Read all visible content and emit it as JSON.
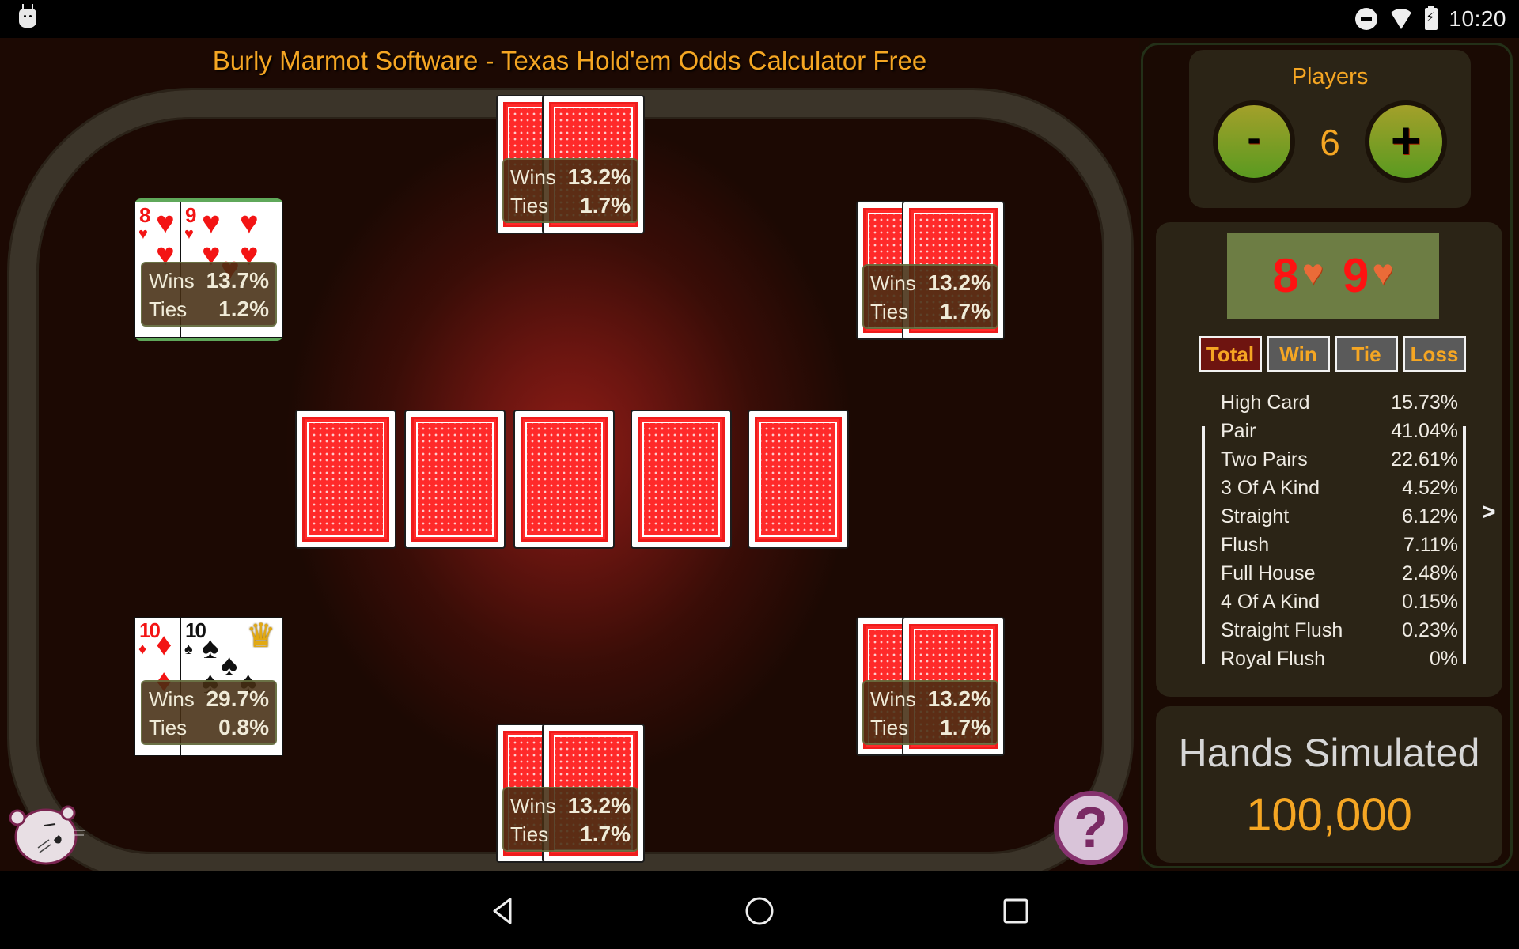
{
  "status_bar": {
    "time": "10:20",
    "icons": [
      "android-debug-icon",
      "do-not-disturb-icon",
      "wifi-icon",
      "battery-charging-icon"
    ]
  },
  "app": {
    "title": "Burly Marmot Software - Texas Hold'em Odds Calculator Free"
  },
  "labels": {
    "wins": "Wins",
    "ties": "Ties"
  },
  "players_seats": [
    {
      "seat": "top",
      "cards": [
        "back",
        "back"
      ],
      "wins": "13.2%",
      "ties": "1.7%"
    },
    {
      "seat": "top-left",
      "cards": [
        "8♥",
        "9♥"
      ],
      "wins": "13.7%",
      "ties": "1.2%",
      "selected": true
    },
    {
      "seat": "top-right",
      "cards": [
        "back",
        "back"
      ],
      "wins": "13.2%",
      "ties": "1.7%"
    },
    {
      "seat": "bottom-left",
      "cards": [
        "10♦",
        "10♠"
      ],
      "wins": "29.7%",
      "ties": "0.8%",
      "leader_crown": true
    },
    {
      "seat": "bottom-right",
      "cards": [
        "back",
        "back"
      ],
      "wins": "13.2%",
      "ties": "1.7%"
    },
    {
      "seat": "bottom",
      "cards": [
        "back",
        "back"
      ],
      "wins": "13.2%",
      "ties": "1.7%"
    }
  ],
  "community_cards": [
    "back",
    "back",
    "back",
    "back",
    "back"
  ],
  "cards": {
    "eight_rank": "8",
    "nine_rank": "9",
    "ten_rank": "10",
    "heart": "♥",
    "diamond": "♦",
    "spade": "♠",
    "crown": "♛"
  },
  "side_panel": {
    "players": {
      "label": "Players",
      "count": "6",
      "minus_label": "-",
      "plus_label": "+"
    },
    "selected_hand": {
      "card1_rank": "8",
      "card1_suit": "♥",
      "card2_rank": "9",
      "card2_suit": "♥"
    },
    "tabs": [
      {
        "label": "Total",
        "active": true
      },
      {
        "label": "Win",
        "active": false
      },
      {
        "label": "Tie",
        "active": false
      },
      {
        "label": "Loss",
        "active": false
      }
    ],
    "hand_stats": [
      {
        "name": "High Card",
        "pct": "15.73%"
      },
      {
        "name": "Pair",
        "pct": "41.04%"
      },
      {
        "name": "Two Pairs",
        "pct": "22.61%"
      },
      {
        "name": "3 Of A Kind",
        "pct": "4.52%"
      },
      {
        "name": "Straight",
        "pct": "6.12%"
      },
      {
        "name": "Flush",
        "pct": "7.11%"
      },
      {
        "name": "Full House",
        "pct": "2.48%"
      },
      {
        "name": "4 Of A Kind",
        "pct": "0.15%"
      },
      {
        "name": "Straight Flush",
        "pct": "0.23%"
      },
      {
        "name": "Royal Flush",
        "pct": "0%"
      }
    ],
    "next_label": ">",
    "hands_simulated": {
      "label": "Hands Simulated",
      "value": "100,000"
    }
  },
  "help": {
    "label": "?"
  },
  "colors": {
    "accent_orange": "#f5a623",
    "panel_bg": "#2b2416",
    "button_green": "#7aa024",
    "tab_active": "#6e1410",
    "tab_inactive": "#5a5a5a",
    "card_back_red": "#ff2a2a"
  }
}
